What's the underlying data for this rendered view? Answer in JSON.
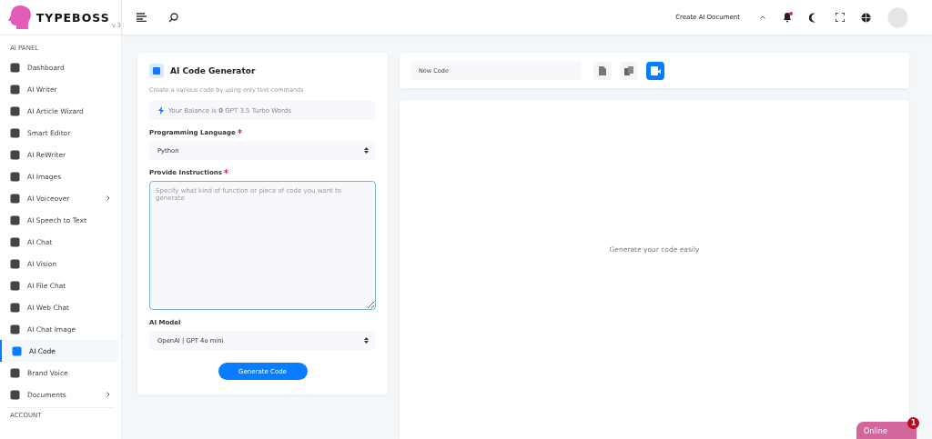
{
  "brand": {
    "name": "TYPEBOSS",
    "version": "v.3"
  },
  "header": {
    "create_label": "Create AI Document",
    "notifications_unread": true
  },
  "sidebar": {
    "section": "AI PANEL",
    "items": [
      {
        "label": "Dashboard",
        "selected": false,
        "submenu": false
      },
      {
        "label": "AI Writer",
        "selected": false,
        "submenu": false
      },
      {
        "label": "AI Article Wizard",
        "selected": false,
        "submenu": false
      },
      {
        "label": "Smart Editor",
        "selected": false,
        "submenu": false
      },
      {
        "label": "AI ReWriter",
        "selected": false,
        "submenu": false
      },
      {
        "label": "AI Images",
        "selected": false,
        "submenu": false
      },
      {
        "label": "AI Voiceover",
        "selected": false,
        "submenu": true
      },
      {
        "label": "AI Speech to Text",
        "selected": false,
        "submenu": false
      },
      {
        "label": "AI Chat",
        "selected": false,
        "submenu": false
      },
      {
        "label": "AI Vision",
        "selected": false,
        "submenu": false
      },
      {
        "label": "AI File Chat",
        "selected": false,
        "submenu": false
      },
      {
        "label": "AI Web Chat",
        "selected": false,
        "submenu": false
      },
      {
        "label": "AI Chat Image",
        "selected": false,
        "submenu": false
      },
      {
        "label": "AI Code",
        "selected": true,
        "submenu": false
      },
      {
        "label": "Brand Voice",
        "selected": false,
        "submenu": false
      },
      {
        "label": "Documents",
        "selected": false,
        "submenu": true
      }
    ],
    "section_2": "ACCOUNT"
  },
  "generator": {
    "title": "AI Code Generator",
    "subtitle": "Create a various code by using only text commands",
    "balance": "Your Balance is **0** GPT 3.5 Turbo Words",
    "language_label": "Programming Language",
    "language_required": true,
    "instructions_required": true,
    "language_value": "Python",
    "instructions_label": "Provide Instructions",
    "instructions_placeholder": "Specify what kind of function or piece of code you want to generate",
    "model_label": "AI Model",
    "model_value": "OpenAI | GPT 4o mini",
    "button": "Generate Code"
  },
  "document": {
    "name": "New Code",
    "empty_message": "Generate your code easily"
  },
  "chat_widget": {
    "label": "Online",
    "badge": "1"
  }
}
